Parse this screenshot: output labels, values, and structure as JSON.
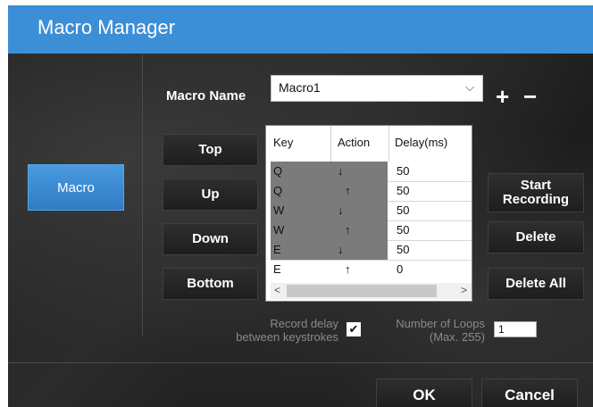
{
  "window": {
    "title": "Macro Manager"
  },
  "sidebar": {
    "macro_label": "Macro"
  },
  "macro_name": {
    "label": "Macro Name",
    "value": "Macro1",
    "chevron": "⌵",
    "add": "+",
    "remove": "−"
  },
  "move_buttons": {
    "top": "Top",
    "up": "Up",
    "down": "Down",
    "bottom": "Bottom"
  },
  "table": {
    "columns": [
      "Key",
      "Action",
      "Delay(ms)"
    ],
    "rows": [
      {
        "key": "Q",
        "action": "↓",
        "delay": "50"
      },
      {
        "key": "Q",
        "action": "↑",
        "delay": "50"
      },
      {
        "key": "W",
        "action": "↓",
        "delay": "50"
      },
      {
        "key": "W",
        "action": "↑",
        "delay": "50"
      },
      {
        "key": "E",
        "action": "↓",
        "delay": "50"
      },
      {
        "key": "E",
        "action": "↑",
        "delay": "0"
      }
    ],
    "scroll_left": "<",
    "scroll_right": ">"
  },
  "right_buttons": {
    "start_line1": "Start",
    "start_line2": "Recording",
    "delete": "Delete",
    "delete_all": "Delete All"
  },
  "options": {
    "record_delay_line1": "Record delay",
    "record_delay_line2": "between keystrokes",
    "record_delay_checked": "✔",
    "loops_line1": "Number of Loops",
    "loops_line2": "(Max. 255)",
    "loops_value": "1"
  },
  "footer": {
    "ok": "OK",
    "cancel": "Cancel"
  },
  "colors": {
    "title_bar": "#3c8ed6",
    "accent": "#2f7cc4"
  }
}
